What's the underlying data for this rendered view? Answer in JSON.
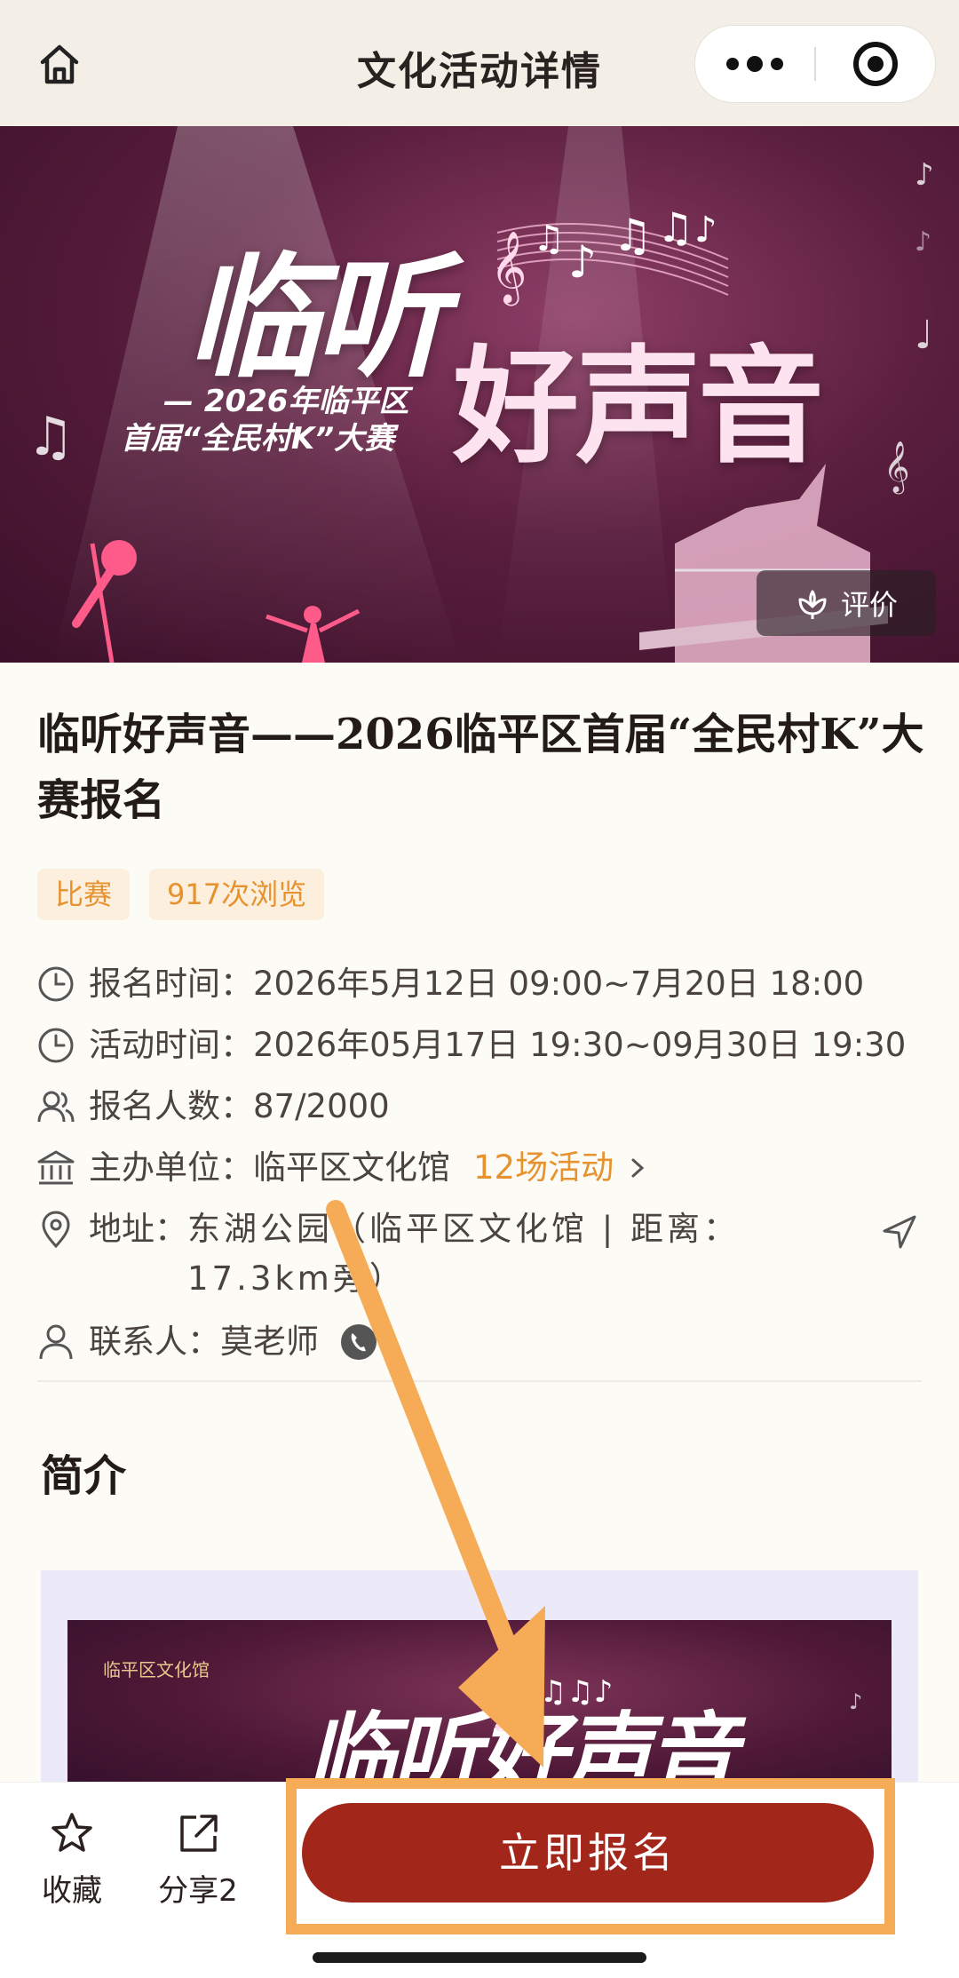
{
  "nav": {
    "title": "文化活动详情"
  },
  "banner": {
    "title_line1": "临听",
    "title_line2": "好声音",
    "subtitle_line1": "— 2026年临平区",
    "subtitle_line2": "首届“全民村K”大赛",
    "review_label": "评价"
  },
  "event": {
    "title": "临听好声音——2026临平区首届“全民村K”大赛报名",
    "tags": [
      "比赛",
      "917次浏览"
    ]
  },
  "info": {
    "signup_time_label": "报名时间：",
    "signup_time_value": "2026年5月12日 09:00~7月20日 18:00",
    "activity_time_label": "活动时间：",
    "activity_time_value": "2026年05月17日 19:30~09月30日 19:30",
    "count_label": "报名人数：",
    "count_value": "87/2000",
    "organizer_label": "主办单位：",
    "organizer_value": "临平区文化馆",
    "organizer_link": "12场活动",
    "address_label": "地址：",
    "address_value": "东湖公园（临平区文化馆 | 距离：17.3km旁）",
    "contact_label": "联系人：",
    "contact_value": "莫老师"
  },
  "intro": {
    "heading": "简介",
    "poster_title": "临听好声音",
    "poster_logo": "临平区文化馆"
  },
  "bottom": {
    "favorite_label": "收藏",
    "share_label": "分享2",
    "signup_label": "立即报名"
  },
  "colors": {
    "accent_orange": "#e6932f",
    "signup_red": "#a3261b",
    "highlight": "#f6ab56"
  }
}
